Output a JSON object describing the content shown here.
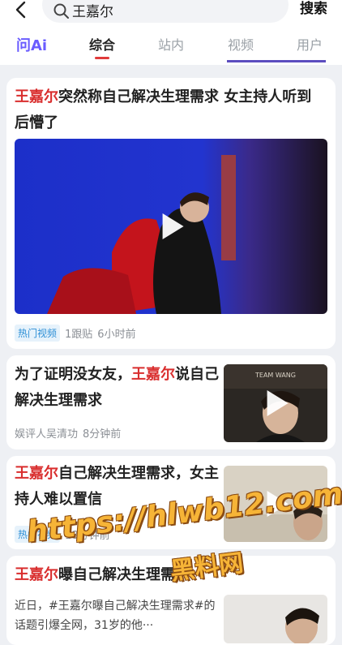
{
  "header": {
    "query": "王嘉尔",
    "search_label": "搜索"
  },
  "tabs": {
    "ai": "问Ai",
    "items": [
      "综合",
      "站内",
      "视频",
      "用户"
    ],
    "active_index": 0
  },
  "results": [
    {
      "title_highlight": "王嘉尔",
      "title_rest": "突然称自己解决生理需求 女主持人听到后懵了",
      "badge": "热门视频",
      "stats": "1跟贴",
      "time": "6小时前"
    },
    {
      "title_prefix": "为了证明没女友，",
      "title_highlight": "王嘉尔",
      "title_rest": "说自己解决生理需求",
      "source": "娱评人吴清功",
      "time": "8分钟前",
      "thumb_text": "TEAM WANG"
    },
    {
      "title_highlight": "王嘉尔",
      "title_rest": "自己解决生理需求，女主持人难以置信",
      "badge": "热门视频",
      "time": "18分钟前"
    },
    {
      "title_highlight": "王嘉尔",
      "title_rest": "曝自己解决生理需求",
      "snippet": "近日，#王嘉尔曝自己解决生理需求#的话题引爆全网，31岁的他···"
    }
  ],
  "watermark": {
    "url": "https://hlwb12.com",
    "site": "黑料网"
  },
  "colors": {
    "highlight": "#d92e2e",
    "accent": "#6a5cff",
    "badge": "#2d8fd6"
  }
}
